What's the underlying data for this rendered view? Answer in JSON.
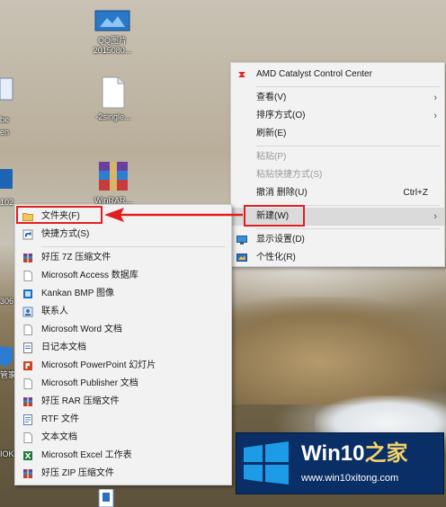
{
  "desktop": {
    "icons": [
      {
        "label_line1": "QQ图片",
        "label_line2": "2015080..."
      },
      {
        "label_line1": "-2single..."
      },
      {
        "label_line1": "WinRAR..."
      }
    ],
    "edge_fragments": [
      "be",
      "en",
      "102",
      "306",
      "管家",
      "IOK"
    ]
  },
  "context_menu": {
    "items": [
      {
        "label": "AMD Catalyst Control Center",
        "icon": "amd-icon"
      },
      {
        "label": "查看(V)",
        "submenu": true
      },
      {
        "label": "排序方式(O)",
        "submenu": true
      },
      {
        "label": "刷新(E)"
      },
      {
        "label": "粘贴(P)",
        "disabled": true
      },
      {
        "label": "粘贴快捷方式(S)",
        "disabled": true
      },
      {
        "label": "撤消 删除(U)",
        "shortcut": "Ctrl+Z"
      },
      {
        "label": "新建(W)",
        "submenu": true
      },
      {
        "label": "显示设置(D)",
        "icon": "display-icon"
      },
      {
        "label": "个性化(R)",
        "icon": "personalize-icon"
      }
    ],
    "arrow_glyph": "›"
  },
  "new_submenu": {
    "items": [
      {
        "label": "文件夹(F)",
        "icon": "folder-icon"
      },
      {
        "label": "快捷方式(S)",
        "icon": "shortcut-icon"
      },
      {
        "label": "好压 7Z 压缩文件",
        "icon": "archive-icon"
      },
      {
        "label": "Microsoft Access 数据库",
        "icon": "access-icon"
      },
      {
        "label": "Kankan BMP 图像",
        "icon": "bmp-icon"
      },
      {
        "label": "联系人",
        "icon": "contact-icon"
      },
      {
        "label": "Microsoft Word 文档",
        "icon": "word-icon"
      },
      {
        "label": "日记本文档",
        "icon": "journal-icon"
      },
      {
        "label": "Microsoft PowerPoint 幻灯片",
        "icon": "powerpoint-icon"
      },
      {
        "label": "Microsoft Publisher 文档",
        "icon": "publisher-icon"
      },
      {
        "label": "好压 RAR 压缩文件",
        "icon": "archive-icon"
      },
      {
        "label": "RTF 文件",
        "icon": "rtf-icon"
      },
      {
        "label": "文本文档",
        "icon": "text-icon"
      },
      {
        "label": "Microsoft Excel 工作表",
        "icon": "excel-icon"
      },
      {
        "label": "好压 ZIP 压缩文件",
        "icon": "archive-icon"
      }
    ]
  },
  "watermark": {
    "brand": "Win10",
    "brand_suffix": "之家",
    "url": "www.win10xitong.com"
  },
  "colors": {
    "menu_bg": "#f2f2f2",
    "highlight": "#dadada",
    "annotation_red": "#e02020",
    "watermark_bg": "#0a2f66",
    "windows_blue": "#1e9be6"
  }
}
